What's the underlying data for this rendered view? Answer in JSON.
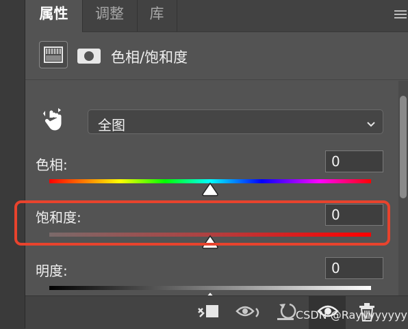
{
  "tabs": [
    {
      "label": "属性",
      "active": true
    },
    {
      "label": "调整",
      "active": false
    },
    {
      "label": "库",
      "active": false
    }
  ],
  "panel": {
    "title": "色相/饱和度",
    "preset": "全图"
  },
  "sliders": [
    {
      "label": "色相:",
      "value": "0",
      "level_fraction": 0.5
    },
    {
      "label": "饱和度:",
      "value": "0",
      "level_fraction": 0.5
    },
    {
      "label": "明度:",
      "value": "0",
      "level_fraction": 0.5
    }
  ],
  "bottom_icons": [
    "clip-to-layer-icon",
    "view-previous-state-icon",
    "reset-icon",
    "visibility-eye-icon",
    "trash-icon"
  ],
  "watermark": "CSDN @Rayyyyyyyy",
  "colors": {
    "highlight": "#e8432d",
    "panel_bg": "#535353"
  }
}
